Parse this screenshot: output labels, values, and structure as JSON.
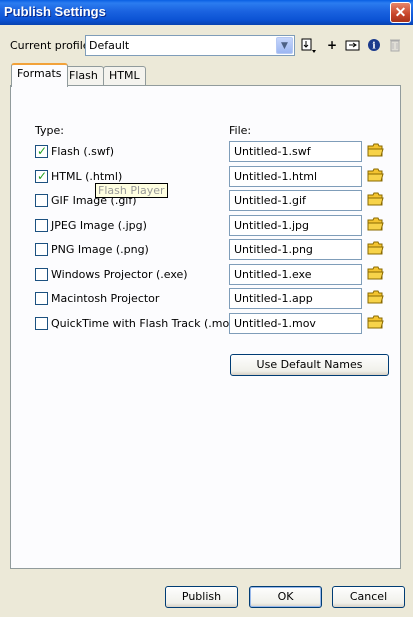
{
  "window": {
    "title": "Publish Settings",
    "close_glyph": "✕"
  },
  "profile": {
    "label": "Current profile:",
    "value": "Default"
  },
  "toolbar": {
    "add_glyph": "+"
  },
  "tabs": [
    "Formats",
    "Flash",
    "HTML"
  ],
  "formats": {
    "type_header": "Type:",
    "file_header": "File:",
    "rows": [
      {
        "label": "Flash  (.swf)",
        "checked": true,
        "file": "Untitled-1.swf"
      },
      {
        "label": "HTML  (.html)",
        "checked": true,
        "file": "Untitled-1.html"
      },
      {
        "label": "GIF Image  (.gif)",
        "checked": false,
        "file": "Untitled-1.gif"
      },
      {
        "label": "JPEG Image  (.jpg)",
        "checked": false,
        "file": "Untitled-1.jpg"
      },
      {
        "label": "PNG Image  (.png)",
        "checked": false,
        "file": "Untitled-1.png"
      },
      {
        "label": "Windows Projector  (.exe)",
        "checked": false,
        "file": "Untitled-1.exe"
      },
      {
        "label": "Macintosh Projector",
        "checked": false,
        "file": "Untitled-1.app"
      },
      {
        "label": "QuickTime with Flash Track  (.mov)",
        "checked": false,
        "file": "Untitled-1.mov"
      }
    ],
    "default_names_label": "Use Default Names",
    "tooltip": "Flash Player"
  },
  "buttons": {
    "publish": "Publish",
    "ok": "OK",
    "cancel": "Cancel"
  },
  "colors": {
    "titlebar": "#0a5fe3",
    "dialog_bg": "#ece9d8",
    "active_tab_accent": "#f2a23a",
    "checkmark": "#21a121"
  }
}
